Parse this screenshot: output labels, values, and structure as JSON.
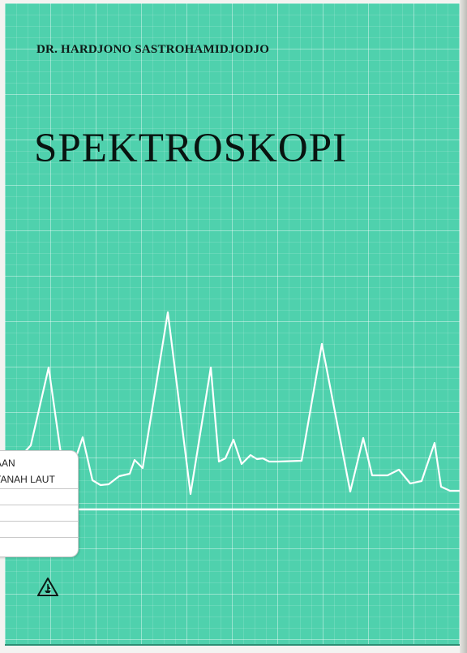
{
  "book": {
    "author": "DR. HARDJONO SASTROHAMIDJODJO",
    "title": "SPEKTROSKOPI"
  },
  "library_label": {
    "line1": "AAN",
    "line2": "TANAH LAUT"
  },
  "colors": {
    "cover": "#4fd1ad",
    "grid": "#ffffff",
    "text": "#081410",
    "trace": "#ffffff"
  },
  "icons": {
    "publisher_logo": "triangle-ship-logo"
  }
}
